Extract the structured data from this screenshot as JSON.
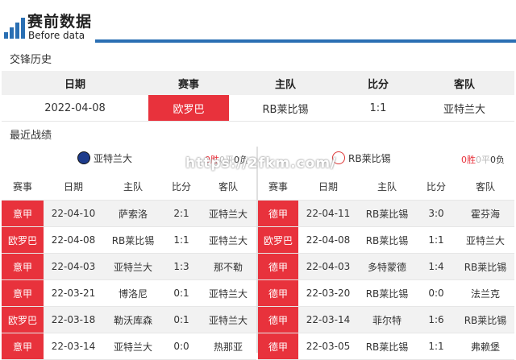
{
  "header": {
    "title": "赛前数据",
    "subtitle": "Before data"
  },
  "h2h": {
    "section_title": "交锋历史",
    "columns": [
      "日期",
      "赛事",
      "主队",
      "比分",
      "客队"
    ],
    "row": {
      "date": "2022-04-08",
      "competition": "欧罗巴",
      "home": "RB莱比锡",
      "score": "1:1",
      "away": "亚特兰大"
    }
  },
  "recent": {
    "section_title": "最近战绩",
    "columns": [
      "赛事",
      "日期",
      "主队",
      "比分",
      "客队"
    ],
    "left": {
      "team": "亚特兰大",
      "record": {
        "win": "0胜",
        "draw": "0平",
        "loss": "0负"
      },
      "rows": [
        {
          "comp": "意甲",
          "date": "22-04-10",
          "home": "萨索洛",
          "score": "2:1",
          "away": "亚特兰大"
        },
        {
          "comp": "欧罗巴",
          "date": "22-04-08",
          "home": "RB莱比锡",
          "score": "1:1",
          "away": "亚特兰大"
        },
        {
          "comp": "意甲",
          "date": "22-04-03",
          "home": "亚特兰大",
          "score": "1:3",
          "away": "那不勒"
        },
        {
          "comp": "意甲",
          "date": "22-03-21",
          "home": "博洛尼",
          "score": "0:1",
          "away": "亚特兰大"
        },
        {
          "comp": "欧罗巴",
          "date": "22-03-18",
          "home": "勒沃库森",
          "score": "0:1",
          "away": "亚特兰大"
        },
        {
          "comp": "意甲",
          "date": "22-03-14",
          "home": "亚特兰大",
          "score": "0:0",
          "away": "热那亚"
        }
      ]
    },
    "right": {
      "team": "RB莱比锡",
      "record": {
        "win": "0胜",
        "draw": "0平",
        "loss": "0负"
      },
      "rows": [
        {
          "comp": "德甲",
          "date": "22-04-11",
          "home": "RB莱比锡",
          "score": "3:0",
          "away": "霍芬海"
        },
        {
          "comp": "欧罗巴",
          "date": "22-04-08",
          "home": "RB莱比锡",
          "score": "1:1",
          "away": "亚特兰大"
        },
        {
          "comp": "德甲",
          "date": "22-04-03",
          "home": "多特蒙德",
          "score": "1:4",
          "away": "RB莱比锡"
        },
        {
          "comp": "德甲",
          "date": "22-03-20",
          "home": "RB莱比锡",
          "score": "0:0",
          "away": "法兰克"
        },
        {
          "comp": "德甲",
          "date": "22-03-14",
          "home": "菲尔特",
          "score": "1:6",
          "away": "RB莱比锡"
        },
        {
          "comp": "德甲",
          "date": "22-03-05",
          "home": "RB莱比锡",
          "score": "1:1",
          "away": "弗赖堡"
        }
      ]
    }
  },
  "watermark": "https://2fkm.com/",
  "colors": {
    "accent": "#2a6fb3",
    "competition": "#e8323c"
  },
  "icons": {
    "logo": "bar-chart-icon",
    "left_badge": "atalanta-crest-icon",
    "right_badge": "leipzig-crest-icon"
  }
}
